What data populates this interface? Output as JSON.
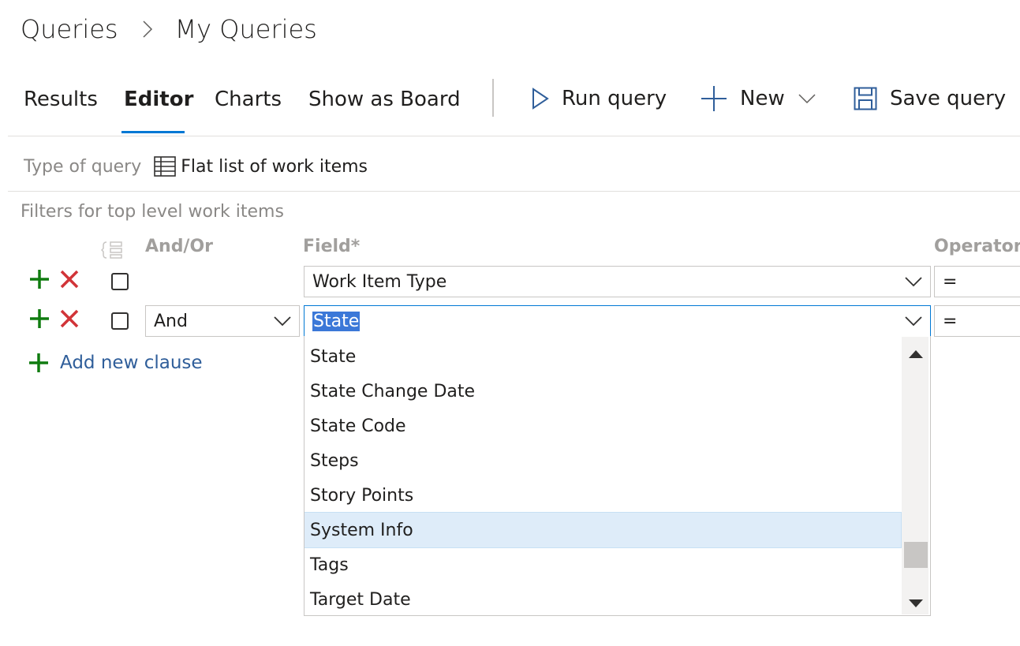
{
  "breadcrumb": {
    "root": "Queries",
    "current": "My Queries"
  },
  "tabs": [
    {
      "label": "Results"
    },
    {
      "label": "Editor"
    },
    {
      "label": "Charts"
    },
    {
      "label": "Show as Board"
    }
  ],
  "commands": {
    "run": "Run query",
    "new": "New",
    "save": "Save query"
  },
  "query_type": {
    "label": "Type of query",
    "value": "Flat list of work items"
  },
  "filters": {
    "title": "Filters for top level work items",
    "headers": {
      "and_or": "And/Or",
      "field": "Field*",
      "operator": "Operator"
    },
    "rows": [
      {
        "and_or": "",
        "field": "Work Item Type",
        "operator": "="
      },
      {
        "and_or": "And",
        "field": "State",
        "operator": "="
      }
    ],
    "add_clause": "Add new clause"
  },
  "dropdown": {
    "items": [
      "State",
      "State Change Date",
      "State Code",
      "Steps",
      "Story Points",
      "System Info",
      "Tags",
      "Target Date"
    ],
    "highlighted": "System Info"
  },
  "colors": {
    "accent": "#0078d4",
    "add_green": "#107c10",
    "delete_red": "#d13438",
    "highlight": "#deecf9"
  }
}
